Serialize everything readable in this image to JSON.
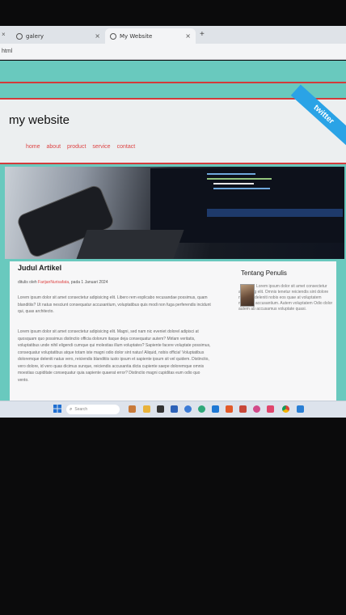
{
  "browser": {
    "tabs": [
      {
        "label": "galery",
        "active": false
      },
      {
        "label": "My Website",
        "active": true
      }
    ],
    "address_fragment": "html",
    "new_tab_symbol": "+",
    "close_symbol": "×"
  },
  "site": {
    "title": "my website",
    "nav": [
      "home",
      "about",
      "product",
      "service",
      "contact"
    ],
    "twitter_label": "twitter"
  },
  "article": {
    "title": "Judul Artikel",
    "byline_prefix": "ditulis oleh",
    "author": "FarijanNurisafata",
    "byline_suffix": ", pada 1 Januari 2024",
    "paragraphs": [
      "Lorem ipsum dolor sit amet consectetur adipisicing elit. Libero rem explicabo recusandae possimus, quam blanditiis? Ut natus nesciunt consequatur accusantium, voluptatibus quis modi non fuga perferendis incidunt qui, quas architecto.",
      "Lorem ipsum dolor sit amet consectetur adipisicing elit. Magni, sed nam nic eveniet dolorel adipisci at quosquam quo possimus distinctio officia dolorum itaque deja consequatur autem? Mirlam veritatis, voluptatibus unde nihil eligendi cumque qui molestias illum voluptates? Sapiente facere voluptate possimus, consequatur voluptatibus atque totam iste magni odio dolor sint natus! Aliquid, nobis officia! Voluptatibus doloremque deleniti natus vero, reiciendis blanditiis iusto ipsum et sapiente ipsum sit vel quidem. Distinctio, vero dolore, id vero quas dicimus sunque, reiciendis accusantia dicta cupiente saepe doloremque omnis moestias cupiditate consequatur quia sapiente quaerat error? Distinctio magni cupiditas eum odio quo vento."
    ]
  },
  "sidebar": {
    "title": "Tentang Penulis",
    "text": "Lorem ipsum dolor sit amet consectetur adipiscing elit. Omnis tenetur reiciendis sint dolore nesciunt deleniti nobis eos quae at voluptatem magnam accusantium. Autem voluptatem Odio dolor autem ab accusamus voluptate quasi."
  },
  "taskbar": {
    "search_placeholder": "Search"
  },
  "colors": {
    "page_bg": "#69c9be",
    "accent_red": "#d23b3b",
    "link": "#d44444",
    "twitter_blue": "#2aa3e6"
  }
}
